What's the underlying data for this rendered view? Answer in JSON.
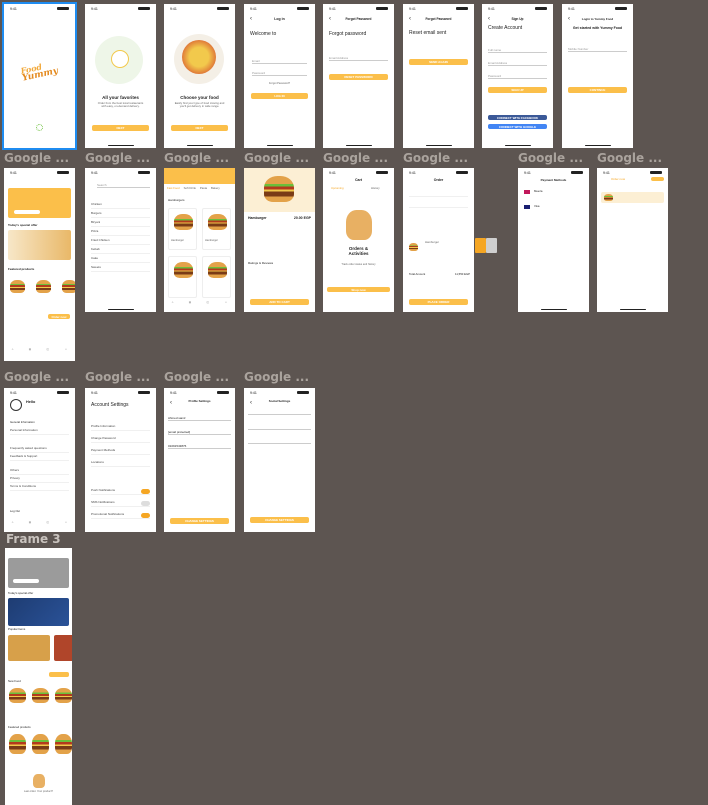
{
  "canvas_bg": "#5d5551",
  "accent": "#fbbf4a",
  "selection": "#1f8cf0",
  "labels": {
    "r2": "Google ...",
    "r3": "Google ...",
    "frame3": "Frame 3"
  },
  "splash": {
    "logo_line1": "Food",
    "logo_line2": "Yummy"
  },
  "onboard1": {
    "title": "All your favorites",
    "body": "Order from the best local restaurants with easy, on-demand delivery.",
    "button": "NEXT"
  },
  "onboard2": {
    "title": "Choose your food",
    "body": "Easily find your type of food craving and you'll get delivery in wide range.",
    "button": "NEXT"
  },
  "login": {
    "header": "Log in",
    "title": "Welcome to",
    "email": "Email",
    "password": "Password",
    "forgot": "Forgot Password?",
    "button": "LOG IN"
  },
  "forgot": {
    "header": "Forgot Password",
    "title": "Forgot password",
    "field": "Email Address",
    "button": "RESET PASSWORD"
  },
  "reset": {
    "header": "Forgot Password",
    "title": "Reset email sent",
    "button": "SEND AGAIN"
  },
  "signup": {
    "header": "Sign Up",
    "title": "Create Account",
    "name": "Full name",
    "email": "Email Address",
    "password": "Password",
    "button": "SIGN UP",
    "facebook": "CONNECT WITH FACEBOOK",
    "google": "CONNECT WITH GOOGLE"
  },
  "start": {
    "header": "Login to Yummy Food",
    "title": "Get started with Yummy Food",
    "field": "Mobile Number",
    "button": "CONTINUE"
  },
  "home": {
    "special": "Today's special offer",
    "featured": "Featured products",
    "button": "Order now"
  },
  "search": {
    "placeholder": "Search",
    "items": [
      "Chicken",
      "Burgers",
      "Biryani",
      "Pizza",
      "Fried Chicken",
      "Kebab",
      "Cake",
      "Sweets"
    ]
  },
  "category": {
    "tabs": [
      "Fast Food",
      "Soft Drink",
      "Pasta",
      "Bakery"
    ],
    "section": "Hamburgers",
    "item1": "Hamburger",
    "item2": "Hamburger"
  },
  "detail": {
    "name": "Hamburger",
    "price": "20.00 EGP",
    "ratings": "Ratings & Reviews",
    "button": "ADD TO CART"
  },
  "cart": {
    "header": "Cart",
    "tab1": "Upcoming",
    "tab2": "History",
    "title": "Orders & Activities",
    "body": "Track order status and history",
    "button": "Shop now"
  },
  "checkout": {
    "header": "Order",
    "item": "Hamburger",
    "total": "Total Amount",
    "total_value": "11,550 EGP",
    "button": "PLACE ORDER"
  },
  "payment": {
    "header": "Payment Methods",
    "m1": "Meeza",
    "m2": "Visa"
  },
  "orders2": {
    "title": "Order now"
  },
  "profile": {
    "name": "Hello",
    "email": "General Information",
    "rows": [
      "Personal Information",
      "Frequently asked questions",
      "Feedback & Support",
      "Others",
      "Privacy",
      "Terms & Conditions"
    ],
    "logout": "Log Out"
  },
  "account": {
    "title": "Account Settings",
    "rows": [
      "Profile Information",
      "Change Password",
      "Payment Methods",
      "Locations",
      "Push Notifications",
      "SMS Notifications",
      "Promotional Notifications"
    ]
  },
  "psettings": {
    "header": "Profile Settings",
    "name": "Ahmed samir",
    "email": "[email protected]",
    "phone": "01091543876",
    "button": "CHANGE SETTINGS"
  },
  "social": {
    "header": "Social Settings",
    "button": "CHANGE SETTINGS"
  },
  "frame3": {
    "special": "Today's special offer",
    "popular": "Popular Items",
    "new": "New Food",
    "featured": "Featured products",
    "footer": "Last order. Your product?"
  }
}
